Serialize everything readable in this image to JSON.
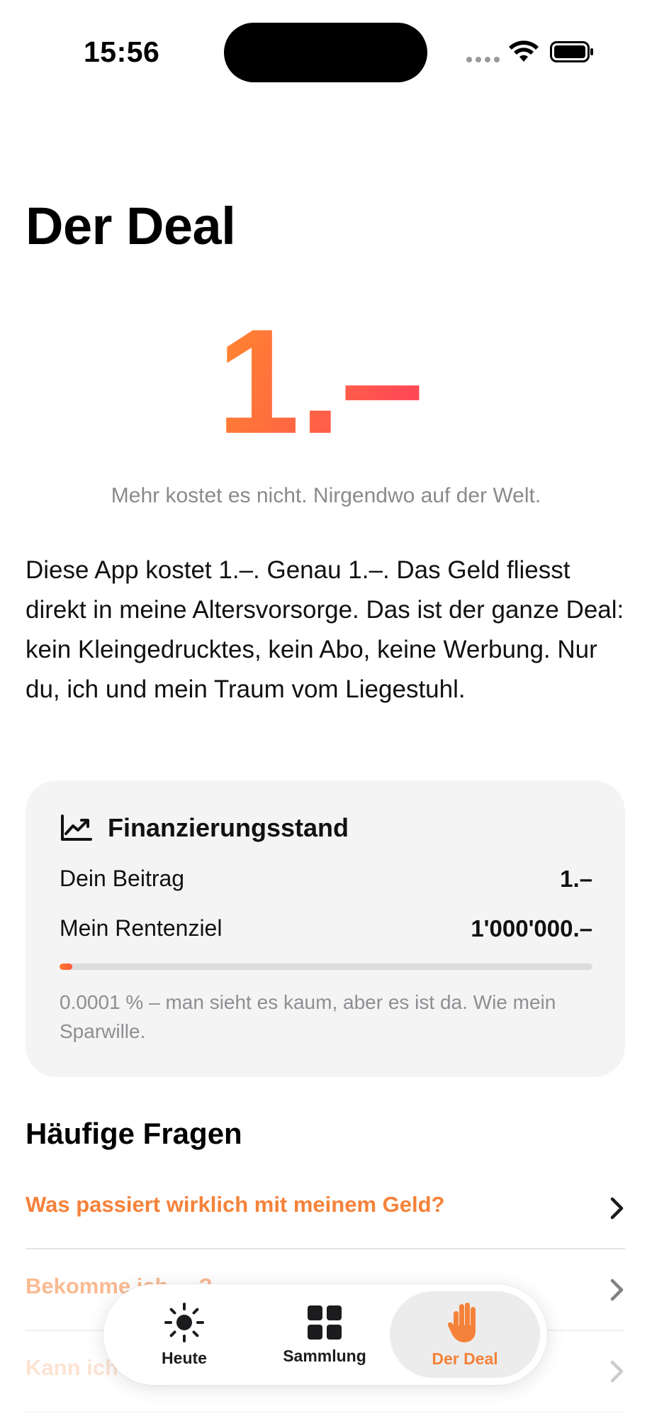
{
  "status_bar": {
    "time": "15:56"
  },
  "page": {
    "title": "Der Deal"
  },
  "price": {
    "value": "1.–",
    "subtitle": "Mehr kostet es nicht. Nirgendwo auf der Welt."
  },
  "intro": "Diese App kostet 1.–. Genau 1.–. Das Geld fliesst direkt in meine Altersvorsorge. Das ist der ganze Deal: kein Kleingedrucktes, kein Abo, keine Werbung. Nur du, ich und mein Traum vom Liegestuhl.",
  "funding_card": {
    "icon": "chart-line-uptrend-icon",
    "title": "Finanzierungsstand",
    "contribution_label": "Dein Beitrag",
    "contribution_value": "1.–",
    "goal_label": "Mein Rentenziel",
    "goal_value": "1'000'000.–",
    "progress_percent": 0.0001,
    "note": "0.0001 % – man sieht es kaum, aber es ist da. Wie mein Sparwille."
  },
  "faq": {
    "title": "Häufige Fragen",
    "items": [
      {
        "question": "Was passiert wirklich mit meinem Geld?"
      },
      {
        "question": "Bekomme ich ... ?"
      },
      {
        "question": "Kann ich ..."
      }
    ]
  },
  "tab_bar": {
    "tabs": [
      {
        "label": "Heute",
        "icon": "sun-icon",
        "selected": false
      },
      {
        "label": "Sammlung",
        "icon": "grid-icon",
        "selected": false
      },
      {
        "label": "Der Deal",
        "icon": "hand-raised-icon",
        "selected": true
      }
    ]
  },
  "colors": {
    "accent": "#F5823A",
    "accent_gradient_end": "#FF4F4F",
    "card_bg": "#F4F4F4",
    "muted": "#8E8E93"
  }
}
